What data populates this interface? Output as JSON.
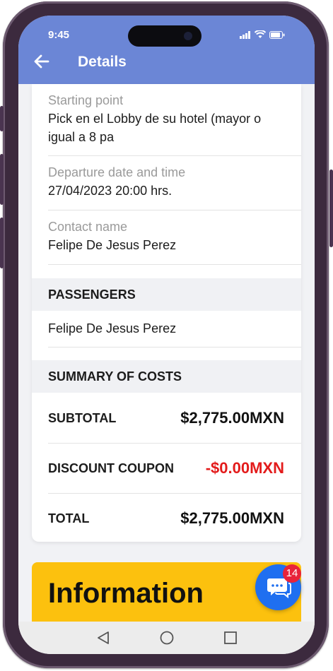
{
  "status": {
    "time": "9:45"
  },
  "appbar": {
    "title": "Details"
  },
  "details": [
    {
      "label": "Starting point",
      "value_line1": "Pick en el Lobby de su hotel (mayor o",
      "value_line2": "igual a 8 pa"
    },
    {
      "label": "Departure date and time",
      "value": "27/04/2023 20:00 hrs."
    },
    {
      "label": "Contact name",
      "value": "Felipe De Jesus Perez"
    }
  ],
  "passengers": {
    "heading": "PASSENGERS",
    "items": [
      "Felipe De Jesus Perez"
    ]
  },
  "costs": {
    "heading": "SUMMARY OF COSTS",
    "rows": [
      {
        "label": "SUBTOTAL",
        "value": "$2,775.00MXN"
      },
      {
        "label": "DISCOUNT COUPON",
        "value": "-$0.00MXN"
      },
      {
        "label": "TOTAL",
        "value": "$2,775.00MXN"
      }
    ]
  },
  "info": {
    "title": "Information"
  },
  "chat": {
    "badge": "14"
  },
  "colors": {
    "appbar": "#6b86d6",
    "banner": "#fcc10e",
    "fab": "#1f6ff0",
    "discount": "#e31b1b"
  },
  "icons": [
    "back-arrow-icon",
    "signal-icon",
    "wifi-icon",
    "battery-icon",
    "chat-icon",
    "nav-back-icon",
    "nav-home-icon",
    "nav-recents-icon"
  ]
}
